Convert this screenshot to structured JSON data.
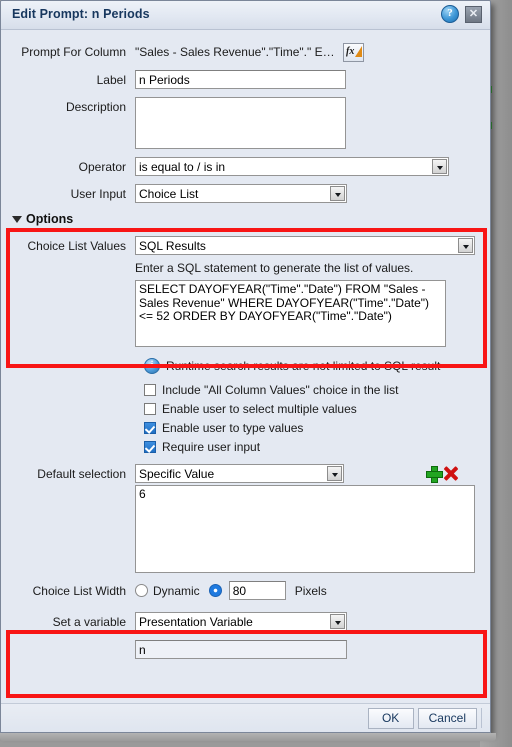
{
  "window": {
    "title": "Edit Prompt: n Periods",
    "help_icon": "help-icon",
    "close_icon": "close-icon"
  },
  "fields": {
    "prompt_for_column": {
      "label": "Prompt For Column",
      "value": "\"Sales - Sales Revenue\".\"Time\".\" E…",
      "edit_button_icon": "fx-edit-icon"
    },
    "label": {
      "label": "Label",
      "value": "n Periods"
    },
    "description": {
      "label": "Description",
      "value": ""
    },
    "operator": {
      "label": "Operator",
      "value": "is equal to / is in"
    },
    "user_input": {
      "label": "User Input",
      "value": "Choice List"
    }
  },
  "options": {
    "header": "Options",
    "disclosure_icon": "triangle-down-icon",
    "choice_list_values": {
      "label": "Choice List Values",
      "value": "SQL Results",
      "hint": "Enter a SQL statement to generate the list of values.",
      "sql": "SELECT DAYOFYEAR(\"Time\".\"Date\") FROM \"Sales - Sales Revenue\" WHERE DAYOFYEAR(\"Time\".\"Date\") <= 52 ORDER BY DAYOFYEAR(\"Time\".\"Date\")"
    },
    "info_note": "Runtime search results are not limited to SQL result",
    "checkboxes": [
      {
        "label": "Include \"All Column Values\" choice in the list",
        "checked": false
      },
      {
        "label": "Enable user to select multiple values",
        "checked": false
      },
      {
        "label": "Enable user to type values",
        "checked": true
      },
      {
        "label": "Require user input",
        "checked": true
      }
    ],
    "default_selection": {
      "label": "Default selection",
      "value": "Specific Value",
      "list_value": "6",
      "add_icon": "add-plus-icon",
      "delete_icon": "delete-x-icon"
    },
    "choice_list_width": {
      "label": "Choice List Width",
      "dynamic_label": "Dynamic",
      "dynamic_selected": false,
      "pixels_selected": true,
      "pixels_value": "80",
      "pixels_label": "Pixels"
    },
    "set_variable": {
      "label": "Set a variable",
      "value": "Presentation Variable",
      "variable_name": "n"
    }
  },
  "footer": {
    "ok_label": "OK",
    "cancel_label": "Cancel"
  },
  "colors": {
    "highlight_red": "#f81515",
    "dialog_bg": "#e4e9f2",
    "title_text": "#17375e"
  }
}
